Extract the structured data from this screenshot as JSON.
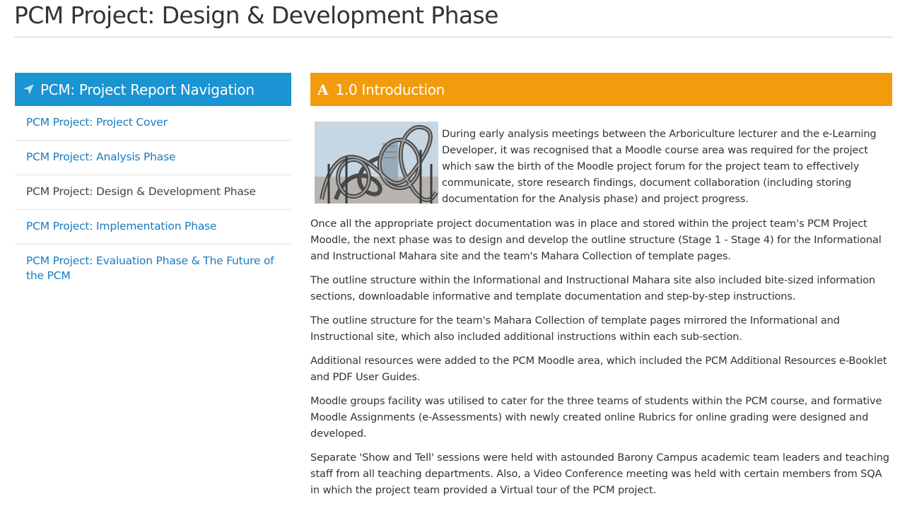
{
  "page": {
    "title": "PCM Project: Design & Development Phase"
  },
  "sidebar": {
    "header": "PCM: Project Report Navigation",
    "header_icon": "location-arrow-icon",
    "header_color": "#1a94d2",
    "items": [
      {
        "label": "PCM Project: Project Cover",
        "link": true
      },
      {
        "label": "PCM Project: Analysis Phase",
        "link": true
      },
      {
        "label": "PCM Project: Design & Development Phase",
        "link": false
      },
      {
        "label": "PCM Project: Implementation Phase",
        "link": true
      },
      {
        "label": "PCM Project: Evaluation Phase & The Future of the PCM",
        "link": true
      }
    ]
  },
  "main": {
    "header": "1.0 Introduction",
    "header_icon": "letter-a-icon",
    "header_icon_glyph": "A",
    "header_color": "#f29b0c",
    "image": "sculpture-photo",
    "intro": "During early analysis meetings between the Arboriculture lecturer and the e-Learning Developer, it was recognised that a Moodle course area was required for the project which saw the birth of the Moodle project forum for the project team to effectively communicate, store research findings, document collaboration (including storing documentation for the Analysis phase) and project progress.",
    "paragraphs": [
      "Once all the appropriate project documentation was in place and stored within the project team's PCM Project Moodle, the next phase was to design and develop the outline structure (Stage 1 - Stage 4) for the Informational and Instructional Mahara site and the team's Mahara Collection of template pages.",
      "The outline structure within the Informational and Instructional Mahara site also included bite-sized information sections, downloadable informative and template documentation and step-by-step instructions.",
      "The outline structure for the team's Mahara Collection of template pages mirrored the Informational and Instructional site, which also included additional instructions within each sub-section.",
      "Additional resources were added to the PCM Moodle area, which included the PCM Additional Resources e-Booklet and PDF User Guides.",
      "Moodle groups facility was utilised to cater for the three teams of students within the PCM course, and formative Moodle Assignments (e-Assessments) with newly created online Rubrics for online grading were designed and developed.",
      "Separate 'Show and Tell' sessions were held with astounded Barony Campus academic team leaders and teaching staff from all teaching departments. Also, a Video Conference meeting was held with certain members from SQA in which the project team provided a Virtual tour of the PCM project."
    ]
  },
  "colors": {
    "link": "#1a7bbf",
    "text": "#333333",
    "title_rule": "#cfcfcf"
  }
}
